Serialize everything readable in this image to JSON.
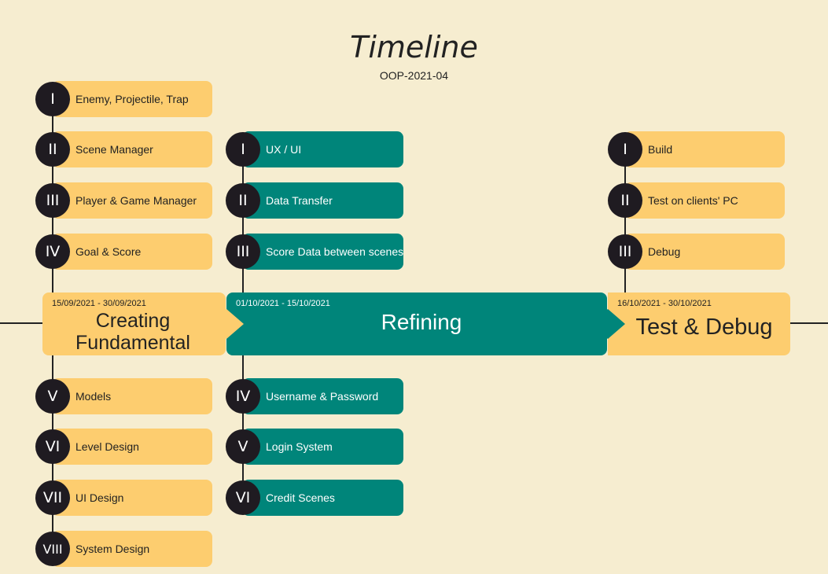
{
  "title": "Timeline",
  "subtitle": "OOP-2021-04",
  "colors": {
    "background": "#f6edd0",
    "yellow": "#fdcd6f",
    "teal": "#00857a",
    "circle": "#1f1b21"
  },
  "phases": [
    {
      "date": "15/09/2021 - 30/09/2021",
      "name": "Creating Fundamental"
    },
    {
      "date": "01/10/2021 - 15/10/2021",
      "name": "Refining"
    },
    {
      "date": "16/10/2021 - 30/10/2021",
      "name": "Test & Debug"
    }
  ],
  "fundamental_tasks": [
    {
      "num": "I",
      "label": "Enemy, Projectile, Trap"
    },
    {
      "num": "II",
      "label": "Scene Manager"
    },
    {
      "num": "III",
      "label": "Player & Game Manager"
    },
    {
      "num": "IV",
      "label": "Goal & Score"
    },
    {
      "num": "V",
      "label": "Models"
    },
    {
      "num": "VI",
      "label": "Level Design"
    },
    {
      "num": "VII",
      "label": "UI Design"
    },
    {
      "num": "VIII",
      "label": "System Design"
    }
  ],
  "refining_tasks": [
    {
      "num": "I",
      "label": "UX / UI"
    },
    {
      "num": "II",
      "label": "Data Transfer"
    },
    {
      "num": "III",
      "label": "Score Data between scenes"
    },
    {
      "num": "IV",
      "label": "Username & Password"
    },
    {
      "num": "V",
      "label": "Login System"
    },
    {
      "num": "VI",
      "label": "Credit Scenes"
    }
  ],
  "test_tasks": [
    {
      "num": "I",
      "label": "Build"
    },
    {
      "num": "II",
      "label": "Test on clients' PC"
    },
    {
      "num": "III",
      "label": "Debug"
    }
  ]
}
